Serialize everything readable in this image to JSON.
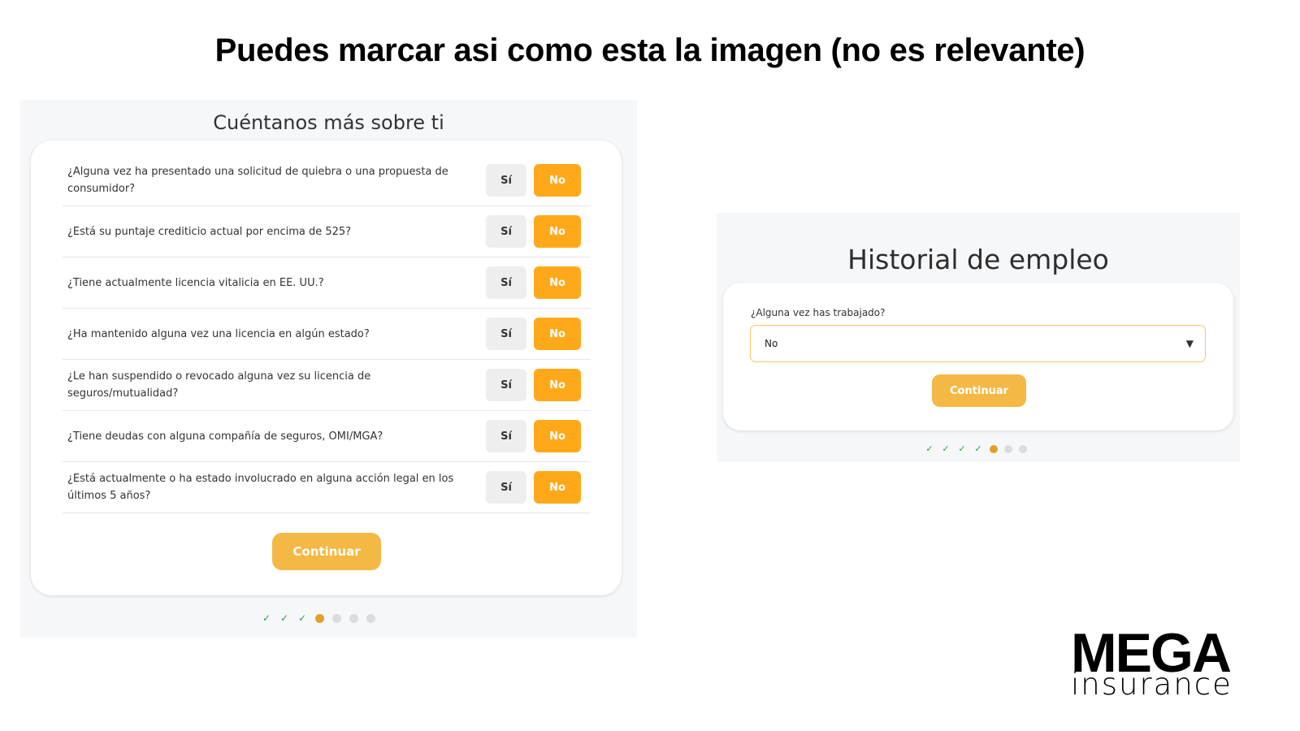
{
  "slide": {
    "title": "Puedes marcar asi como esta la imagen (no es relevante)"
  },
  "left_form": {
    "heading": "Cuéntanos más sobre ti",
    "questions": [
      {
        "text": "¿Alguna vez ha presentado una solicitud de quiebra o una propuesta de consumidor?",
        "yes": "Sí",
        "no": "No"
      },
      {
        "text": "¿Está su puntaje crediticio actual por encima de 525?",
        "yes": "Sí",
        "no": "No"
      },
      {
        "text": "¿Tiene actualmente licencia vitalicia en EE. UU.?",
        "yes": "Sí",
        "no": "No"
      },
      {
        "text": "¿Ha mantenido alguna vez una licencia en algún estado?",
        "yes": "Sí",
        "no": "No"
      },
      {
        "text": "¿Le han suspendido o revocado alguna vez su licencia de seguros/mutualidad?",
        "yes": "Sí",
        "no": "No"
      },
      {
        "text": "¿Tiene deudas con alguna compañía de seguros, OMI/MGA?",
        "yes": "Sí",
        "no": "No"
      },
      {
        "text": "¿Está actualmente o ha estado involucrado en alguna acción legal en los últimos 5 años?",
        "yes": "Sí",
        "no": "No"
      }
    ],
    "continue_label": "Continuar",
    "progress": {
      "completed_steps": 3,
      "current_step": 4,
      "total_steps": 7
    }
  },
  "right_form": {
    "heading": "Historial de empleo",
    "field_label": "¿Alguna vez has trabajado?",
    "select_value": "No",
    "continue_label": "Continuar",
    "progress": {
      "completed_steps": 4,
      "current_step": 5,
      "total_steps": 7
    }
  },
  "logo": {
    "top": "MEGA",
    "bottom": "insurance"
  },
  "colors": {
    "accent_orange": "#ffa91a",
    "continue_button": "#f4b844",
    "check_green": "#2f9e45",
    "active_dot": "#e39f2a",
    "inactive_dot": "#dcdcdc",
    "panel_bg": "#f6f7f9"
  },
  "icons": {
    "check": "check-icon",
    "caret": "caret-down-icon"
  }
}
